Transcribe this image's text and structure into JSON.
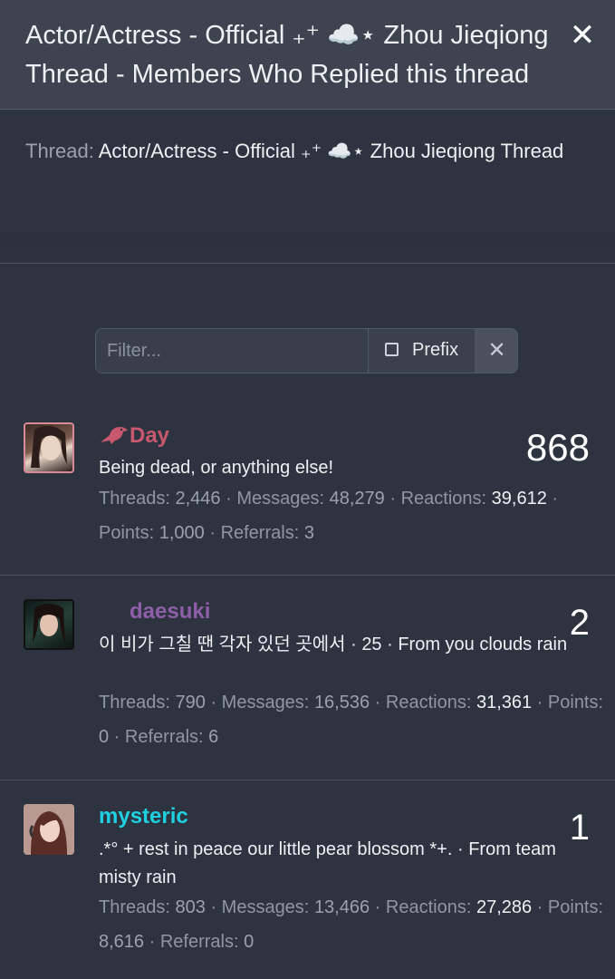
{
  "header": {
    "title": "Actor/Actress - Official ₊⁺ ☁️⋆ Zhou Jieqiong Thread - Members Who Replied this thread",
    "close_icon": "close-icon"
  },
  "thread_info": {
    "label": "Thread:",
    "name": "Actor/Actress - Official ₊⁺ ☁️⋆ Zhou Jieqiong Thread"
  },
  "filter": {
    "placeholder": "Filter...",
    "prefix_label": "Prefix",
    "clear_icon": "close-icon"
  },
  "members": [
    {
      "username": "Day",
      "username_color": "#c8586e",
      "username_icon": "bird-icon",
      "title": "Being dead, or anything else!",
      "threads_label": "Threads:",
      "threads": "2,446",
      "messages_label": "Messages:",
      "messages": "48,279",
      "reactions_label": "Reactions:",
      "reactions": "39,612",
      "points_label": "Points:",
      "points": "1,000",
      "referrals_label": "Referrals:",
      "referrals": "3",
      "count": "868"
    },
    {
      "username": "daesuki",
      "username_color": "#8e5fa8",
      "title": "이 비가 그칠 땐 각자 있던 곳에서 · 25 · From you clouds rain",
      "threads_label": "Threads:",
      "threads": "790",
      "messages_label": "Messages:",
      "messages": "16,536",
      "reactions_label": "Reactions:",
      "reactions": "31,361",
      "points_label": "Points:",
      "points": "0",
      "referrals_label": "Referrals:",
      "referrals": "6",
      "count": "2"
    },
    {
      "username": "mysteric",
      "username_color": "#1fd0e0",
      "title": ".*° + rest in peace our little pear blossom *+. · From team misty rain",
      "threads_label": "Threads:",
      "threads": "803",
      "messages_label": "Messages:",
      "messages": "13,466",
      "reactions_label": "Reactions:",
      "reactions": "27,286",
      "points_label": "Points:",
      "points": "8,616",
      "referrals_label": "Referrals:",
      "referrals": "0",
      "count": "1"
    }
  ]
}
